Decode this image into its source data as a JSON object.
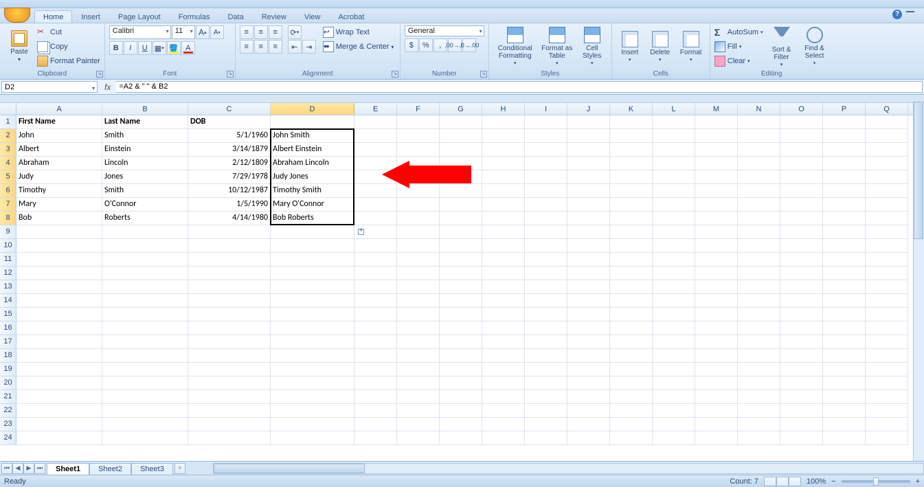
{
  "tabs": [
    "Home",
    "Insert",
    "Page Layout",
    "Formulas",
    "Data",
    "Review",
    "View",
    "Acrobat"
  ],
  "active_tab": "Home",
  "clipboard": {
    "label": "Clipboard",
    "paste": "Paste",
    "cut": "Cut",
    "copy": "Copy",
    "format_painter": "Format Painter"
  },
  "font": {
    "label": "Font",
    "family": "Calibri",
    "size": "11",
    "bold": "B",
    "italic": "I",
    "underline": "U"
  },
  "alignment": {
    "label": "Alignment",
    "wrap": "Wrap Text",
    "merge": "Merge & Center"
  },
  "number": {
    "label": "Number",
    "format": "General",
    "currency": "$",
    "percent": "%",
    "comma": ","
  },
  "styles": {
    "label": "Styles",
    "cond": "Conditional Formatting",
    "fmt_table": "Format as Table",
    "cell": "Cell Styles"
  },
  "cells": {
    "label": "Cells",
    "insert": "Insert",
    "delete": "Delete",
    "format": "Format"
  },
  "editing": {
    "label": "Editing",
    "autosum": "AutoSum",
    "fill": "Fill",
    "clear": "Clear",
    "sort": "Sort & Filter",
    "find": "Find & Select"
  },
  "namebox": "D2",
  "formula": "=A2 & \" \" & B2",
  "columns": [
    "A",
    "B",
    "C",
    "D",
    "E",
    "F",
    "G",
    "H",
    "I",
    "J",
    "K",
    "L",
    "M",
    "N",
    "O",
    "P",
    "Q"
  ],
  "col_widths": {
    "A": 125,
    "B": 125,
    "C": 120,
    "D": 122,
    "default": 62
  },
  "headers": {
    "A": "First Name",
    "B": "Last Name",
    "C": "DOB"
  },
  "rows": [
    {
      "A": "John",
      "B": "Smith",
      "C": "5/1/1960",
      "D": "John Smith"
    },
    {
      "A": "Albert",
      "B": "Einstein",
      "C": "3/14/1879",
      "D": "Albert Einstein"
    },
    {
      "A": "Abraham",
      "B": "Lincoln",
      "C": "2/12/1809",
      "D": "Abraham Lincoln"
    },
    {
      "A": "Judy",
      "B": "Jones",
      "C": "7/29/1978",
      "D": "Judy Jones"
    },
    {
      "A": "Timothy",
      "B": "Smith",
      "C": "10/12/1987",
      "D": "Timothy Smith"
    },
    {
      "A": "Mary",
      "B": "O'Connor",
      "C": "1/5/1990",
      "D": "Mary O'Connor"
    },
    {
      "A": "Bob",
      "B": "Roberts",
      "C": "4/14/1980",
      "D": "Bob Roberts"
    }
  ],
  "total_rows": 24,
  "selected_col": "D",
  "selected_rows": [
    2,
    3,
    4,
    5,
    6,
    7,
    8
  ],
  "sheets": [
    "Sheet1",
    "Sheet2",
    "Sheet3"
  ],
  "active_sheet": "Sheet1",
  "status": {
    "ready": "Ready",
    "count": "Count: 7",
    "zoom": "100%"
  }
}
